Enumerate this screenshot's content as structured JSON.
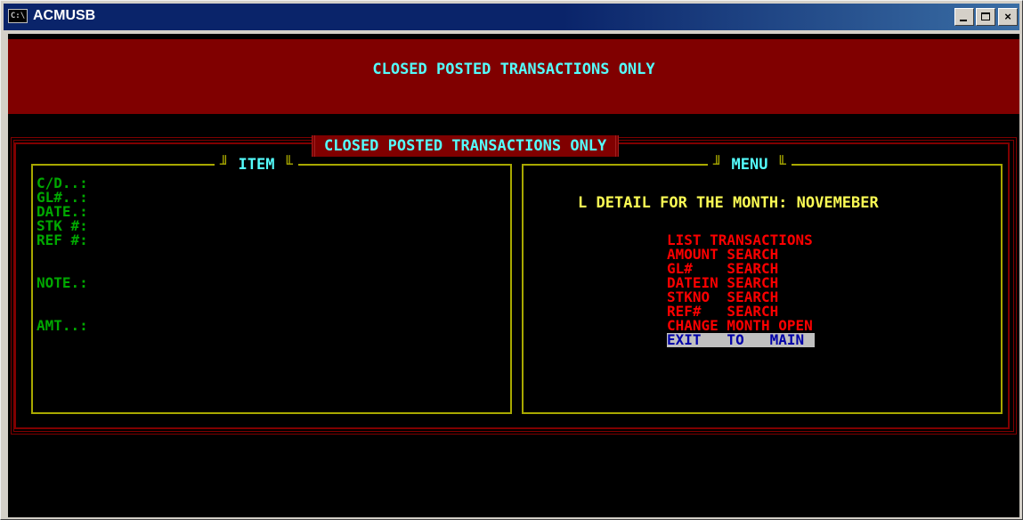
{
  "window": {
    "title": "ACMUSB",
    "icon": "console-icon",
    "icon_text": "C:\\",
    "minimize_icon": "minimize-icon",
    "maximize_icon": "maximize-icon",
    "close_label": "×"
  },
  "banner": {
    "title": "CLOSED POSTED TRANSACTIONS ONLY"
  },
  "frame": {
    "title": "CLOSED POSTED TRANSACTIONS ONLY"
  },
  "item_panel": {
    "title": "ITEM",
    "fields": [
      {
        "label": "C/D..:"
      },
      {
        "label": "GL#..:"
      },
      {
        "label": "DATE.:"
      },
      {
        "label": "STK #:"
      },
      {
        "label": "REF #:"
      },
      {
        "label": "NOTE.:"
      },
      {
        "label": "AMT..:"
      }
    ]
  },
  "menu_panel": {
    "title": "MENU",
    "month_line": "L DETAIL FOR THE MONTH: NOVEMEBER",
    "items": [
      {
        "label": "LIST TRANSACTIONS"
      },
      {
        "label": "AMOUNT SEARCH"
      },
      {
        "label": "GL#    SEARCH"
      },
      {
        "label": "DATEIN SEARCH"
      },
      {
        "label": "STKNO  SEARCH"
      },
      {
        "label": "REF#   SEARCH"
      },
      {
        "label": "CHANGE MONTH OPEN"
      },
      {
        "label": "EXIT   TO   MAIN"
      }
    ],
    "selected_index": 7
  },
  "colors": {
    "banner_bg": "#800000",
    "title_text": "#54fcfc",
    "field_text": "#00a800",
    "menu_text": "#fc0000",
    "month_text": "#fcfc54",
    "selected_bg": "#c0c0c0",
    "selected_text": "#0000a8",
    "panel_border": "#a8a800"
  }
}
